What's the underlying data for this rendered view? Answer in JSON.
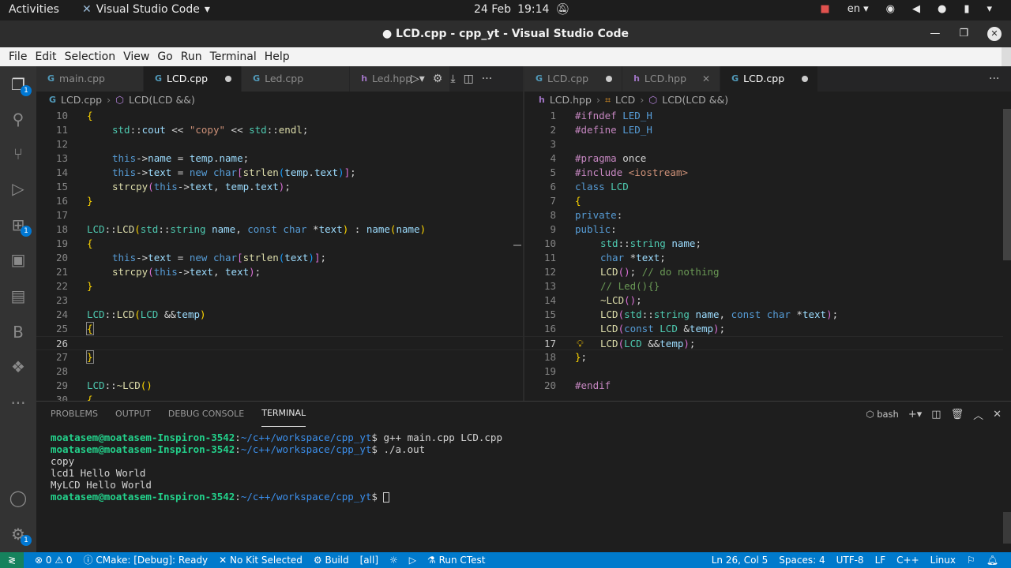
{
  "system_bar": {
    "activities": "Activities",
    "app_name": "Visual Studio Code",
    "date": "24 Feb",
    "time": "19:14",
    "lang": "en"
  },
  "window": {
    "title": "● LCD.cpp - cpp_yt - Visual Studio Code"
  },
  "menu": [
    "File",
    "Edit",
    "Selection",
    "View",
    "Go",
    "Run",
    "Terminal",
    "Help"
  ],
  "activity_bar": {
    "explorer_badge": "1",
    "extensions_badge": "1",
    "settings_badge": "1",
    "b_label": "B"
  },
  "left_editor": {
    "tabs": [
      {
        "label": "main.cpp",
        "modified": false,
        "active": false
      },
      {
        "label": "LCD.cpp",
        "modified": true,
        "active": true
      },
      {
        "label": "Led.cpp",
        "modified": false,
        "active": false
      },
      {
        "label": "Led.hpp",
        "modified": false,
        "active": false
      }
    ],
    "breadcrumb": [
      "LCD.cpp",
      "LCD(LCD &&)"
    ],
    "line_numbers": [
      "10",
      "11",
      "12",
      "13",
      "14",
      "15",
      "16",
      "17",
      "18",
      "19",
      "20",
      "21",
      "22",
      "23",
      "24",
      "25",
      "26",
      "27",
      "28",
      "29",
      "30"
    ]
  },
  "right_editor": {
    "tabs": [
      {
        "label": "LCD.cpp",
        "modified": true,
        "active": false
      },
      {
        "label": "LCD.hpp",
        "modified": false,
        "active": false
      },
      {
        "label": "LCD.cpp",
        "modified": true,
        "active": true
      }
    ],
    "breadcrumb": [
      "LCD.hpp",
      "LCD",
      "LCD(LCD &&)"
    ],
    "line_numbers": [
      "1",
      "2",
      "3",
      "4",
      "5",
      "6",
      "7",
      "8",
      "9",
      "10",
      "11",
      "12",
      "13",
      "14",
      "15",
      "16",
      "17",
      "18",
      "19",
      "20"
    ]
  },
  "panel": {
    "tabs": [
      "PROBLEMS",
      "OUTPUT",
      "DEBUG CONSOLE",
      "TERMINAL"
    ],
    "active_tab": "TERMINAL",
    "shell": "bash",
    "terminal": {
      "prompt_user": "moatasem@moatasem-Inspiron-3542",
      "prompt_path": "~/c++/workspace/cpp_yt",
      "commands": [
        "g++ main.cpp LCD.cpp",
        "./a.out"
      ],
      "output": [
        "copy",
        "lcd1 Hello World",
        "MyLCD Hello World"
      ]
    }
  },
  "status_bar": {
    "errors": "0",
    "warnings": "0",
    "cmake": "CMake: [Debug]: Ready",
    "kit": "No Kit Selected",
    "build": "Build",
    "target": "[all]",
    "ctest": "Run CTest",
    "cursor": "Ln 26, Col 5",
    "spaces": "Spaces: 4",
    "encoding": "UTF-8",
    "eol": "LF",
    "language": "C++",
    "os": "Linux"
  }
}
